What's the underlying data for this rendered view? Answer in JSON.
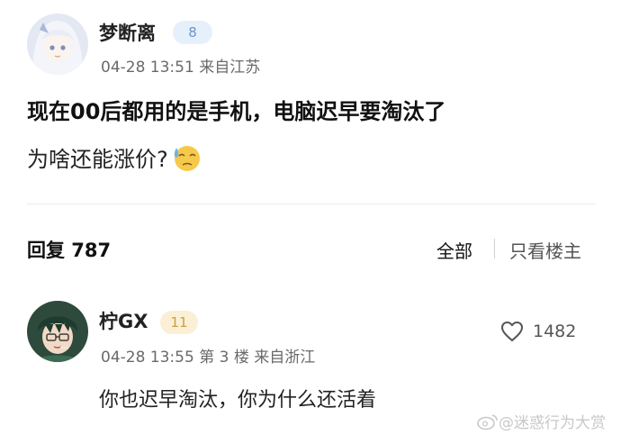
{
  "post": {
    "username": "梦断离",
    "level": "8",
    "meta": "04-28 13:51 来自江苏",
    "title": "现在00后都用的是手机，电脑迟早要淘汰了",
    "body": "为啥还能涨价?"
  },
  "replies_header": {
    "count_label": "回复 787",
    "tab_all": "全部",
    "tab_op_only": "只看楼主"
  },
  "reply": {
    "username": "柠GX",
    "level": "11",
    "meta": "04-28 13:55 第 3 楼 来自浙江",
    "text": "你也迟早淘汰，你为什么还活着",
    "likes": "1482"
  },
  "watermark": "@迷惑行为大赏",
  "colors": {
    "badge_blue_bg": "#e6f0fb",
    "badge_blue_text": "#6a94cf",
    "badge_gold_bg": "#fbf0d6",
    "badge_gold_text": "#caa040"
  }
}
